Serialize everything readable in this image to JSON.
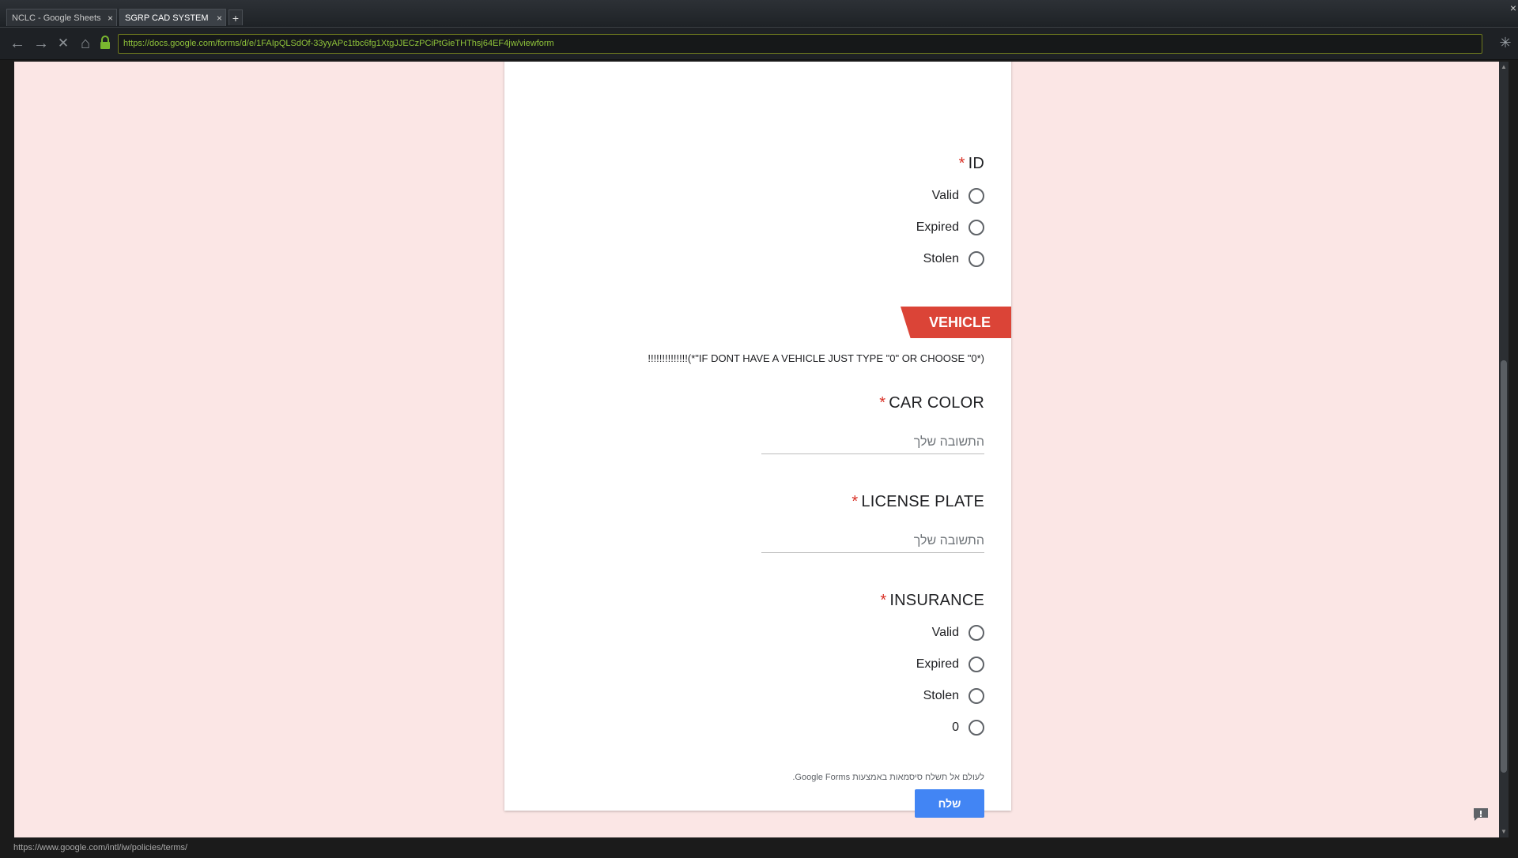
{
  "tabs": [
    {
      "label": "NCLC - Google Sheets",
      "close": "×"
    },
    {
      "label": "SGRP CAD SYSTEM",
      "close": "×"
    }
  ],
  "tab_add": "+",
  "window_close": "×",
  "nav": {
    "back": "←",
    "forward": "→",
    "stop": "✕",
    "home": "⌂",
    "url": "https://docs.google.com/forms/d/e/1FAIpQLSdOf-33yyAPc1tbc6fg1XtgJJECzPCiPtGieTHThsj64EF4jw/viewform",
    "spinner": "✳"
  },
  "form": {
    "id_question": {
      "title": "ID",
      "required": "*",
      "options": [
        "Valid",
        "Expired",
        "Stolen"
      ]
    },
    "section": {
      "title": "VEHICLE",
      "description": "!!!!!!!!!!!!!!(*\"IF DONT HAVE A VEHICLE JUST TYPE \"0\" OR CHOOSE \"0*)"
    },
    "car_color": {
      "title": "CAR COLOR",
      "required": "*",
      "placeholder": "התשובה שלך"
    },
    "license_plate": {
      "title": "LICENSE PLATE",
      "required": "*",
      "placeholder": "התשובה שלך"
    },
    "insurance": {
      "title": "INSURANCE",
      "required": "*",
      "options": [
        "Valid",
        "Expired",
        "Stolen",
        "0"
      ]
    },
    "submit_label": "שלח",
    "footer_note": "לעולם אל תשלח סיסמאות באמצעות Google Forms."
  },
  "status_url": "https://www.google.com/intl/iw/policies/terms/",
  "colors": {
    "page_background": "#fbe6e5",
    "section_banner": "#db4437",
    "required_marker": "#d93025",
    "submit_button": "#4285f4",
    "url_text": "#8fc33a"
  }
}
